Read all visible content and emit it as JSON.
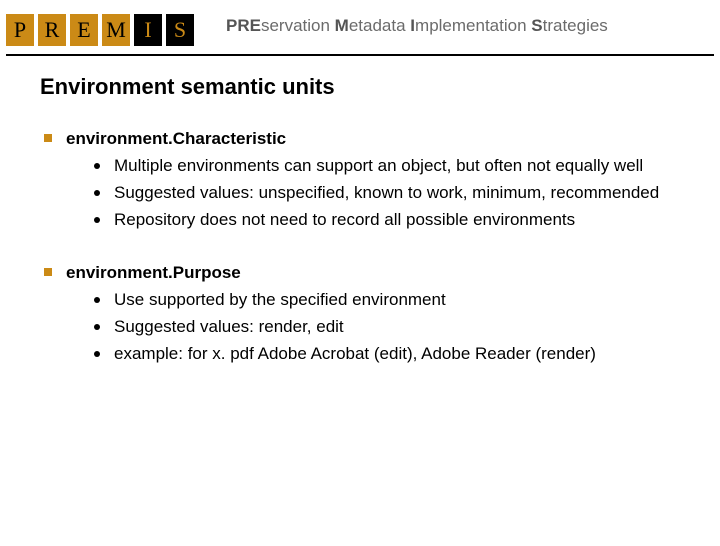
{
  "banner": {
    "logo_letters": [
      "P",
      "R",
      "E",
      "M",
      "I",
      "S"
    ],
    "tagline_em_1": "PRE",
    "tagline_plain_1": "servation ",
    "tagline_em_2": "M",
    "tagline_plain_2": "etadata ",
    "tagline_em_3": "I",
    "tagline_plain_3": "mplementation ",
    "tagline_em_4": "S",
    "tagline_plain_4": "trategies"
  },
  "title": "Environment semantic units",
  "sections": [
    {
      "heading": "environment.Characteristic",
      "items": [
        "Multiple environments can support an object, but often not equally well",
        "Suggested values: unspecified, known to work, minimum, recommended",
        "Repository does not need to record all possible environments"
      ]
    },
    {
      "heading": "environment.Purpose",
      "items": [
        "Use supported by the specified environment",
        "Suggested values: render, edit",
        "example: for x. pdf Adobe Acrobat (edit), Adobe Reader (render)"
      ]
    }
  ]
}
